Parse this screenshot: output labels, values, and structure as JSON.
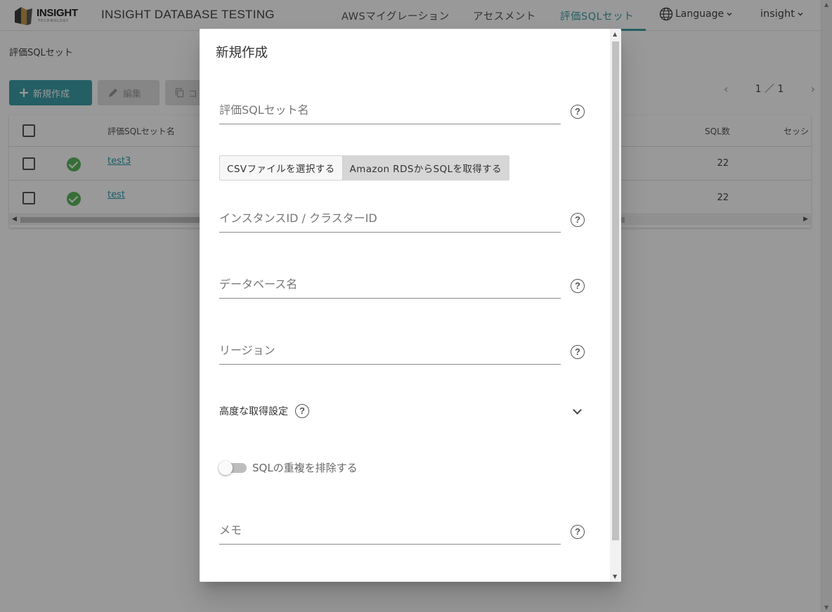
{
  "header": {
    "logo_text": "INSIGHT",
    "logo_sub": "TECHNOLOGY",
    "app_title": "INSIGHT DATABASE TESTING",
    "nav": [
      {
        "label": "AWSマイグレーション"
      },
      {
        "label": "アセスメント"
      },
      {
        "label": "評価SQLセット"
      }
    ],
    "language_label": "Language",
    "user_label": "insight"
  },
  "page": {
    "breadcrumb": "評価SQLセット",
    "toolbar": {
      "new_label": "新規作成",
      "edit_label": "編集",
      "copy_label": "コ"
    },
    "pager": {
      "current": "1",
      "separator": "／",
      "total": "1"
    },
    "table": {
      "columns": {
        "name": "評価SQLセット名",
        "sql_count": "SQL数",
        "session": "セッシ"
      },
      "rows": [
        {
          "name": "test3",
          "sql_count": "22"
        },
        {
          "name": "test",
          "sql_count": "22"
        }
      ]
    }
  },
  "dialog": {
    "title": "新規作成",
    "set_name_placeholder": "評価SQLセット名",
    "source_options": [
      "CSVファイルを選択する",
      "Amazon RDSからSQLを取得する"
    ],
    "instance_placeholder": "インスタンスID / クラスターID",
    "database_placeholder": "データベース名",
    "region_placeholder": "リージョン",
    "advanced_label": "高度な取得設定",
    "dedupe_label": "SQLの重複を排除する",
    "memo_placeholder": "メモ",
    "help_glyph": "?"
  },
  "colors": {
    "accent": "#3d9ea8",
    "success": "#5cb85c",
    "link": "#2a9bab"
  }
}
